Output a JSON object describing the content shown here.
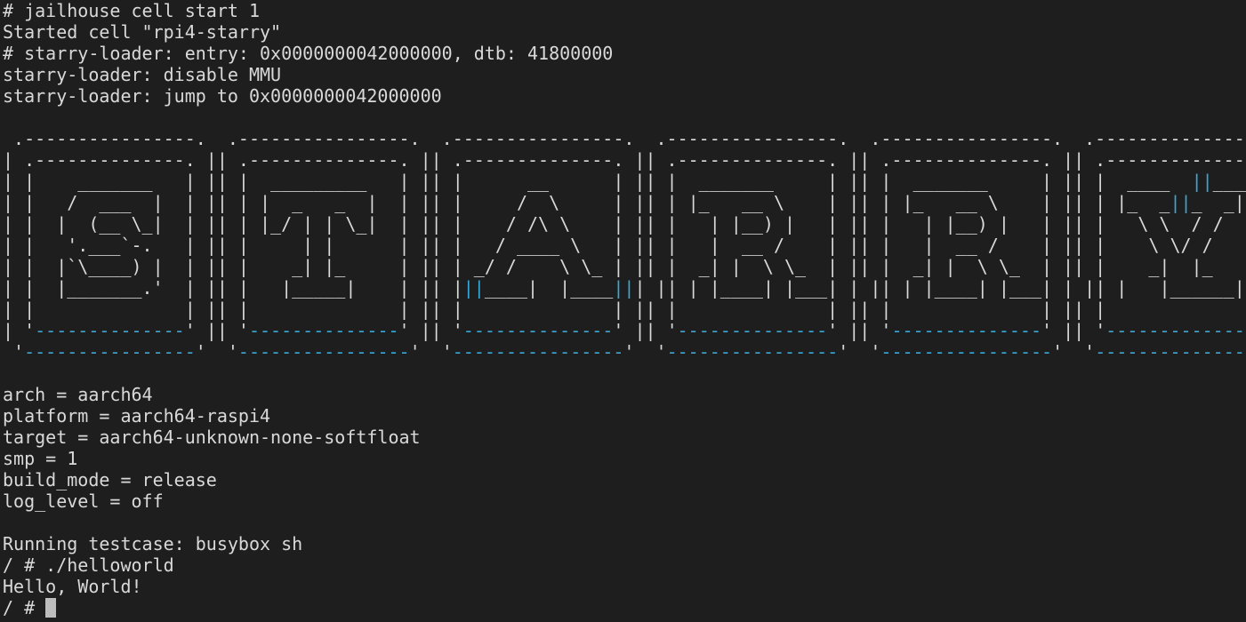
{
  "boot": [
    "# jailhouse cell start 1",
    "Started cell \"rpi4-starry\"",
    "# starry-loader: entry: 0x0000000042000000, dtb: 41800000",
    "starry-loader: disable MMU",
    "starry-loader: jump to 0x0000000042000000"
  ],
  "banner": [
    [
      " .----------------.  .----------------.  .----------------.  .----------------.  .----------------.  .----------------."
    ],
    [
      "| .--------------. || .--------------. || .--------------. || .--------------. || .--------------. || .--------------. |"
    ],
    [
      "| |    _______   | || |  _________   | || |      __      | || |  _______     | || |  _______     | || |  ____  ",
      {
        "c": "||"
      },
      "____ | |"
    ],
    [
      "| |   /  ___  |  | || | |  _   _  |  | || |     /  \\     | || | |_   __ \\    | || | |_   __ \\    | || | |_  _",
      {
        "c": "||"
      },
      "_  _| | |"
    ],
    [
      "| |  |  (__ \\_|  | || | |_/ | | \\_|  | || |    / /\\ \\    | || |   | |__) |   | || |   | |__) |   | || |   \\ \\  / /   | |"
    ],
    [
      "| |   '.___`-.   | || |     | |      | || |   / ____ \\   | || |   |  __ /    | || |   |  __ /    | || |    \\ \\/ /    | |"
    ],
    [
      "| |  |`\\____) |  | || |    _| |_     | || | _/ /    \\ \\_ | || |  _| |  \\ \\_  | || |  _| |  \\ \\_  | || |    _|  |_    | |"
    ],
    [
      "| |  |_______.'  | || |   |_____|    | || |",
      {
        "c": "||"
      },
      "____|  |____",
      {
        "c": "||"
      },
      "| || | |____| |___| | || | |____| |___| | || |   |______|   | |"
    ],
    [
      "| |              | || |              | || |              | || |              | || |              | || |              | |"
    ],
    [
      "| '",
      {
        "c": "--------------"
      },
      "' || '",
      {
        "c": "--------------"
      },
      "' || '",
      {
        "c": "--------------"
      },
      "' || '",
      {
        "c": "--------------"
      },
      "' || '",
      {
        "c": "--------------"
      },
      "' || '",
      {
        "c": "--------------"
      },
      "' |"
    ],
    [
      " '",
      {
        "c": "----------------"
      },
      "'  '",
      {
        "c": "----------------"
      },
      "'  '",
      {
        "c": "----------------"
      },
      "'  '",
      {
        "c": "----------------"
      },
      "'  '",
      {
        "c": "----------------"
      },
      "'  '",
      {
        "c": "----------------"
      },
      "'"
    ]
  ],
  "config": [
    "arch = aarch64",
    "platform = aarch64-raspi4",
    "target = aarch64-unknown-none-softfloat",
    "smp = 1",
    "build_mode = release",
    "log_level = off"
  ],
  "session": [
    "Running testcase: busybox sh",
    "/ # ./helloworld",
    "Hello, World!"
  ],
  "prompt": "/ # ",
  "colors": {
    "background": "#1e1e1e",
    "foreground": "#d9d9d9",
    "accent": "#3aa7d6",
    "cursor": "#bdbdbd"
  }
}
